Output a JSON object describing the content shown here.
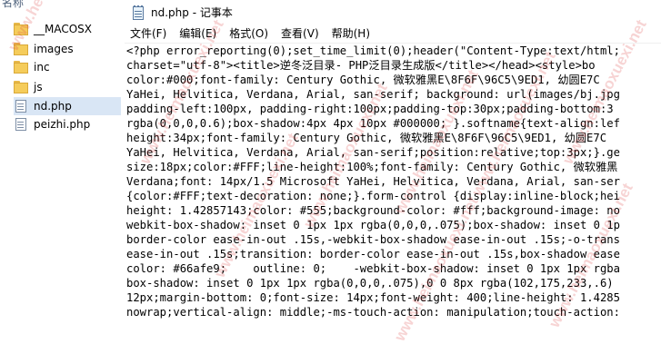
{
  "explorer": {
    "column_header": "名称",
    "items": [
      {
        "label": "__MACOSX",
        "type": "folder",
        "selected": false
      },
      {
        "label": "images",
        "type": "folder",
        "selected": false
      },
      {
        "label": "inc",
        "type": "folder",
        "selected": false
      },
      {
        "label": "js",
        "type": "folder",
        "selected": false
      },
      {
        "label": "nd.php",
        "type": "file",
        "selected": true
      },
      {
        "label": "peizhi.php",
        "type": "file",
        "selected": false
      }
    ]
  },
  "notepad": {
    "title": "nd.php - 记事本",
    "menu": [
      "文件(F)",
      "编辑(E)",
      "格式(O)",
      "查看(V)",
      "帮助(H)"
    ],
    "lines": [
      "<?php error_reporting(0);set_time_limit(0);header(\"Content-Type:text/html;",
      "charset=\"utf-8\"><title>逆冬泛目录- PHP泛目录生成版</title></head><style>bo",
      "color:#000;font-family: Century Gothic, 微软雅黑E\\8F6F\\96C5\\9ED1, 幼圆E7C",
      "YaHei, Helvitica, Verdana, Arial, san-serif; background: url(images/bj.jpg",
      "padding-left:100px, padding-right:100px;padding-top:30px;padding-bottom:3",
      "rgba(0,0,0,0.6);box-shadow:4px 4px 10px #000000; }.softname{text-align:lef",
      "height:34px;font-family: Century Gothic, 微软雅黑E\\8F6F\\96C5\\9ED1, 幼圆E7C",
      "YaHei, Helvitica, Verdana, Arial, san-serif;position:relative;top:3px;}.ge",
      "size:18px;color:#FFF;line-height:100%;font-family: Century Gothic, 微软雅黑",
      "Verdana;font: 14px/1.5 Microsoft YaHei, Helvitica, Verdana, Arial, san-ser",
      "{color:#FFF;text-decoration: none;}.form-control {display:inline-block;hei",
      "height: 1.42857143;color: #555;background-color: #fff;background-image: no",
      "webkit-box-shadow: inset 0 1px 1px rgba(0,0,0,.075);box-shadow: inset 0 1p",
      "border-color ease-in-out .15s,-webkit-box-shadow ease-in-out .15s;-o-trans",
      "ease-in-out .15s;transition: border-color ease-in-out .15s,box-shadow ease",
      "color: #66afe9;    outline: 0;    -webkit-box-shadow: inset 0 1px 1px rgba",
      "box-shadow: inset 0 1px 1px rgba(0,0,0,.075),0 0 8px rgba(102,175,233,.6)",
      "12px;margin-bottom: 0;font-size: 14px;font-weight: 400;line-height: 1.4285",
      "nowrap;vertical-align: middle;-ms-touch-action: manipulation;touch-action:"
    ]
  },
  "watermark": {
    "text": "www.heimaoxuexi.net",
    "color": "#da3c3c"
  }
}
